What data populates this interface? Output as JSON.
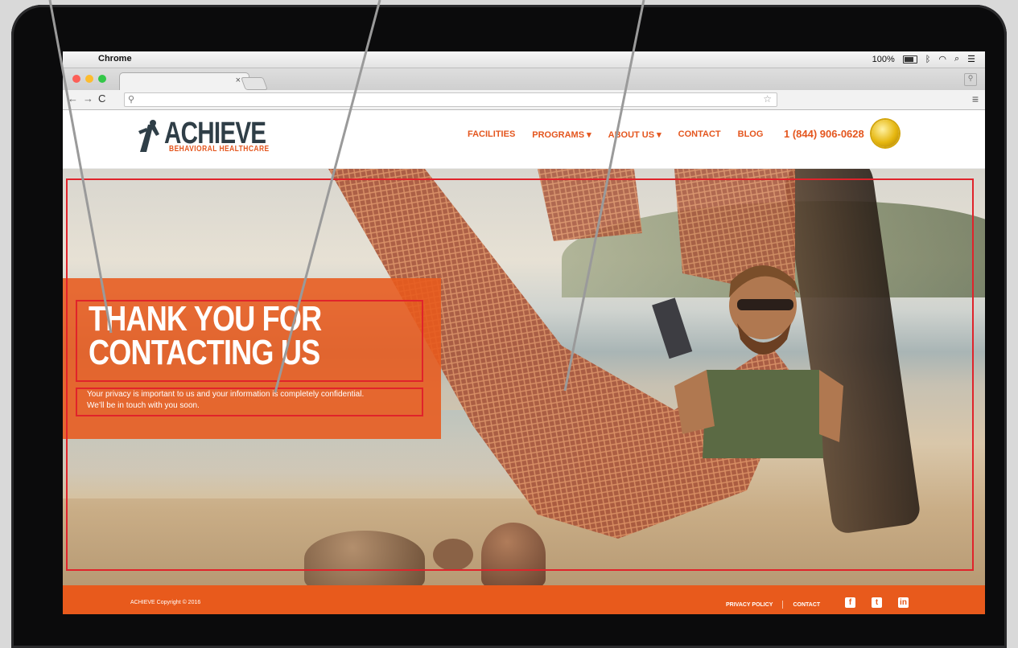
{
  "menubar": {
    "app_name": "Chrome",
    "status_text": "100%",
    "battery_icon": "battery-icon",
    "bluetooth_icon": "bluetooth-icon",
    "wifi_icon": "wifi-icon",
    "search_icon": "search-icon",
    "list_icon": "list-icon"
  },
  "browser": {
    "tab_close": "×",
    "address_placeholder": "",
    "nav_icons": [
      "back-arrow-icon",
      "forward-arrow-icon",
      "reload-icon"
    ]
  },
  "site": {
    "logo_name": "ACHIEVE",
    "logo_sub": "BEHAVIORAL HEALTHCARE",
    "nav": [
      {
        "label": "FACILITIES"
      },
      {
        "label": "PROGRAMS ▾"
      },
      {
        "label": "ABOUT US ▾"
      },
      {
        "label": "CONTACT"
      },
      {
        "label": "BLOG"
      }
    ],
    "phone": "1 (844) 906-0628",
    "accreditation_seal": "gold-seal-icon"
  },
  "hero": {
    "title_line1": "THANK YOU FOR",
    "title_line2": "CONTACTING US",
    "text_line1": "Your privacy is important to us and your information is completely confidential.",
    "text_line2": "We’ll be in touch with you soon.",
    "panel_color": "#e85a1c"
  },
  "footer": {
    "copyright": "ACHIEVE Copyright © 2016",
    "privacy_label": "PRIVACY POLICY",
    "contact_label": "CONTACT",
    "social": [
      {
        "icon": "facebook-icon",
        "glyph": "f"
      },
      {
        "icon": "twitter-icon",
        "glyph": "t"
      },
      {
        "icon": "linkedin-icon",
        "glyph": "in"
      }
    ]
  },
  "colors": {
    "brand_orange": "#e85a1c",
    "logo_dark": "#2f3e47",
    "annotation_red": "#e0232b"
  }
}
